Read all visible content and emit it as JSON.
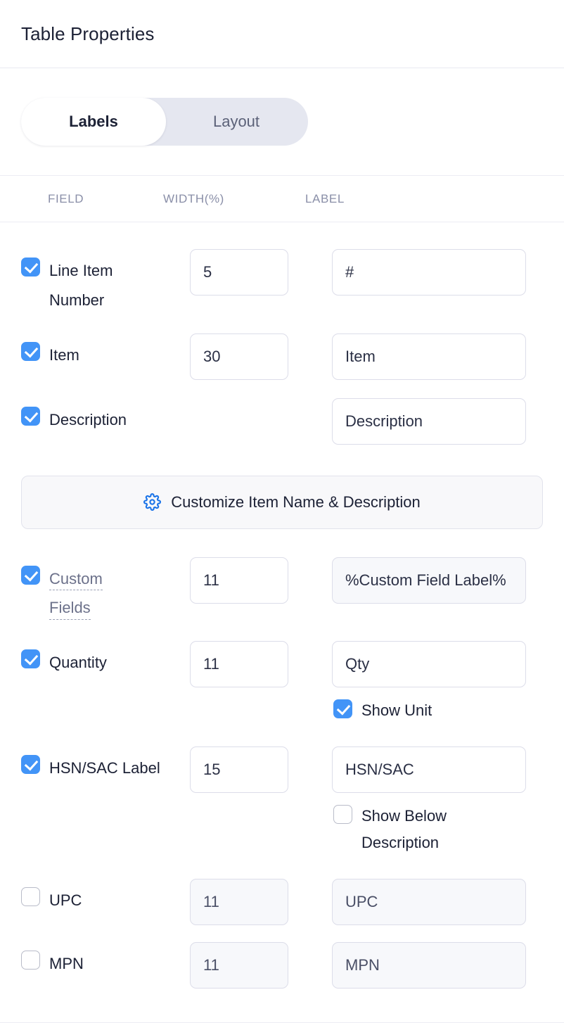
{
  "header": {
    "title": "Table Properties"
  },
  "tabs": [
    {
      "label": "Labels",
      "active": true
    },
    {
      "label": "Layout",
      "active": false
    }
  ],
  "columns": {
    "field": "FIELD",
    "width": "WIDTH(%)",
    "label": "LABEL"
  },
  "customize_button": {
    "label": "Customize Item Name & Description",
    "icon": "gear-icon",
    "icon_color": "#1a73e8"
  },
  "rows": [
    {
      "field": "Line Item Number",
      "checked": true,
      "width": "5",
      "label": "#",
      "has_width": true,
      "has_label": true,
      "disabled": false
    },
    {
      "field": "Item",
      "checked": true,
      "width": "30",
      "label": "Item",
      "has_width": true,
      "has_label": true,
      "disabled": false
    },
    {
      "field": "Description",
      "checked": true,
      "width": "",
      "label": "Description",
      "has_width": false,
      "has_label": true,
      "disabled": false
    },
    {
      "field": "Custom Fields",
      "checked": true,
      "width": "11",
      "label": "%Custom Field Label%",
      "has_width": true,
      "has_label": true,
      "disabled": false,
      "hint_underline": true,
      "label_shaded": true
    },
    {
      "field": "Quantity",
      "checked": true,
      "width": "11",
      "label": "Qty",
      "has_width": true,
      "has_label": true,
      "disabled": false,
      "subcheck": {
        "label": "Show Unit",
        "checked": true
      }
    },
    {
      "field": "HSN/SAC Label",
      "checked": true,
      "width": "15",
      "label": "HSN/SAC",
      "has_width": true,
      "has_label": true,
      "disabled": false,
      "subcheck": {
        "label": "Show Below Description",
        "checked": false
      }
    },
    {
      "field": "UPC",
      "checked": false,
      "width": "11",
      "label": "UPC",
      "has_width": true,
      "has_label": true,
      "disabled": true
    },
    {
      "field": "MPN",
      "checked": false,
      "width": "11",
      "label": "MPN",
      "has_width": true,
      "has_label": true,
      "disabled": true
    }
  ],
  "colors": {
    "accent": "#4294f7",
    "icon_blue": "#1a73e8",
    "tab_track": "#e5e7f0",
    "border": "#dcdde9",
    "text": "#1c2135",
    "muted": "#8a8fa8"
  }
}
